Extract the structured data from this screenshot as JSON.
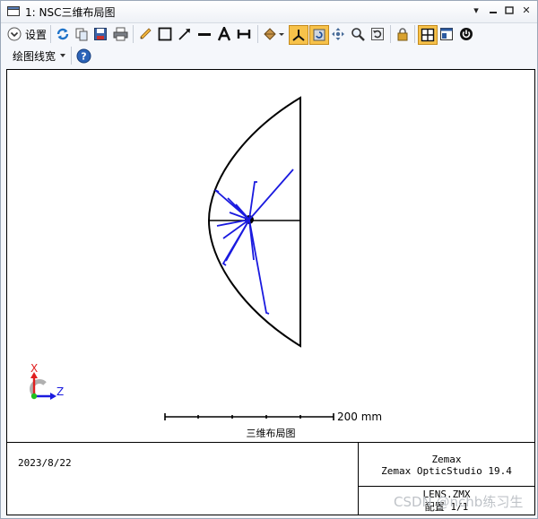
{
  "window": {
    "title": "1: NSC三维布局图",
    "minimize": "▾",
    "close": "✕"
  },
  "toolbar": {
    "settings_label": "设置",
    "line_width_label": "绘图线宽"
  },
  "plot": {
    "axis_x": "X",
    "axis_z": "Z",
    "scale_label": "200 mm"
  },
  "footer": {
    "title": "三维布局图",
    "date": "2023/8/22",
    "company": "Zemax",
    "product": "Zemax OpticStudio 19.4",
    "file": "LENS.ZMX",
    "config": "配置 1/1"
  },
  "watermark": "CSDN @nchb练习生",
  "colors": {
    "ray": "#1a1adf",
    "outline": "#000000",
    "axis_x": "#e02020",
    "axis_z": "#1a1adf",
    "highlight": "#f7c24a"
  }
}
